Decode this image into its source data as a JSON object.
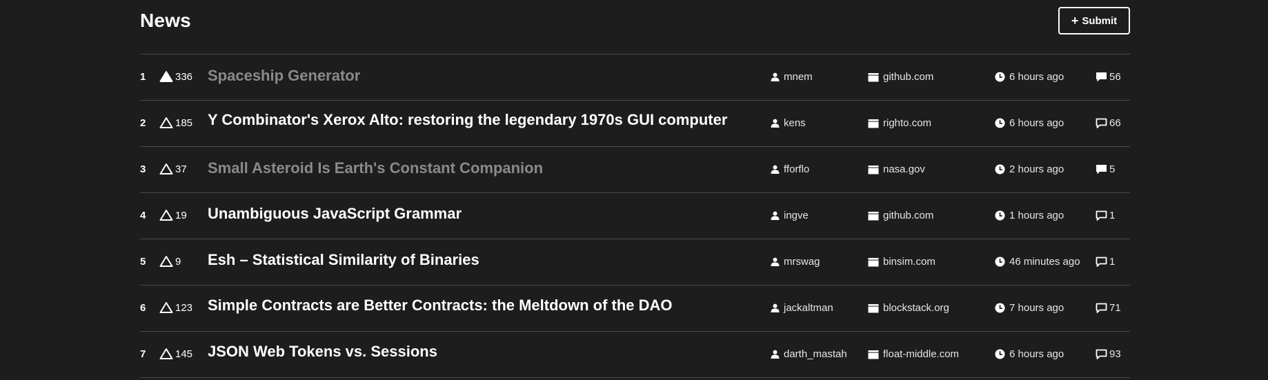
{
  "header": {
    "title": "News",
    "submit_label": "Submit",
    "submit_icon": "plus-icon"
  },
  "icons": {
    "upvote": "triangle-up-icon",
    "author": "user-icon",
    "domain": "folder-icon",
    "time": "clock-icon",
    "comments": "comment-icon"
  },
  "items": [
    {
      "rank": "1",
      "votes": "336",
      "voted": true,
      "visited": true,
      "title": "Spaceship Generator",
      "author": "mnem",
      "domain": "github.com",
      "time": "6 hours ago",
      "comments": "56"
    },
    {
      "rank": "2",
      "votes": "185",
      "voted": false,
      "visited": false,
      "title": "Y Combinator's Xerox Alto: restoring the legendary 1970s GUI computer",
      "author": "kens",
      "domain": "righto.com",
      "time": "6 hours ago",
      "comments": "66"
    },
    {
      "rank": "3",
      "votes": "37",
      "voted": false,
      "visited": true,
      "title": "Small Asteroid Is Earth's Constant Companion",
      "author": "fforflo",
      "domain": "nasa.gov",
      "time": "2 hours ago",
      "comments": "5"
    },
    {
      "rank": "4",
      "votes": "19",
      "voted": false,
      "visited": false,
      "title": "Unambiguous JavaScript Grammar",
      "author": "ingve",
      "domain": "github.com",
      "time": "1 hours ago",
      "comments": "1"
    },
    {
      "rank": "5",
      "votes": "9",
      "voted": false,
      "visited": false,
      "title": "Esh – Statistical Similarity of Binaries",
      "author": "mrswag",
      "domain": "binsim.com",
      "time": "46 minutes ago",
      "comments": "1"
    },
    {
      "rank": "6",
      "votes": "123",
      "voted": false,
      "visited": false,
      "title": "Simple Contracts are Better Contracts: the Meltdown of the DAO",
      "author": "jackaltman",
      "domain": "blockstack.org",
      "time": "7 hours ago",
      "comments": "71"
    },
    {
      "rank": "7",
      "votes": "145",
      "voted": false,
      "visited": false,
      "title": "JSON Web Tokens vs. Sessions",
      "author": "darth_mastah",
      "domain": "float-middle.com",
      "time": "6 hours ago",
      "comments": "93"
    }
  ]
}
